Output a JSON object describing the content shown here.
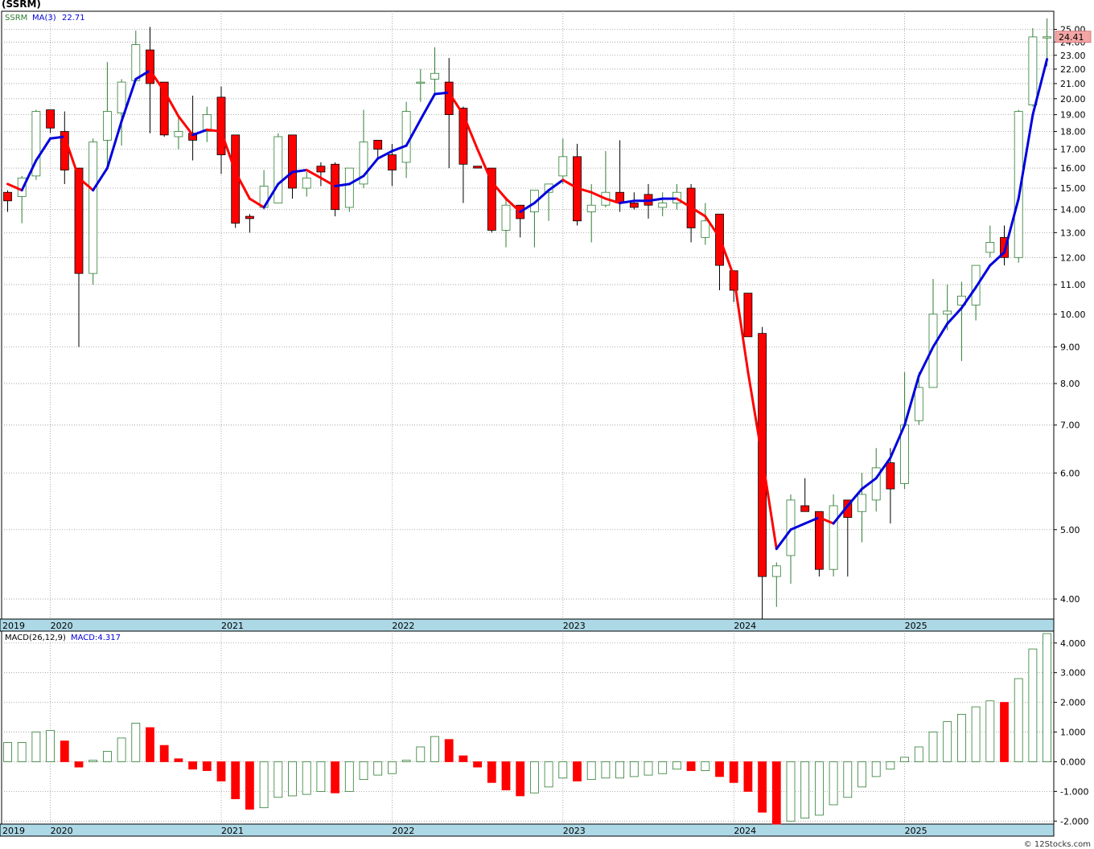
{
  "title": "(SSRM)",
  "watermark": "© 12Stocks.com",
  "colors": {
    "up_candle": "#2e7d32",
    "down_candle": "#ff0000",
    "ma_up": "#0000dd",
    "ma_down": "#ff0000",
    "macd_up": "#2e7d32",
    "macd_down": "#ff0000",
    "grid": "#999999",
    "axis_band": "#add8e6",
    "price_label_bg": "#f4a6a6"
  },
  "chart_data": [
    {
      "type": "candlestick",
      "name": "price-panel",
      "legend": {
        "symbol": "SSRM",
        "ma_label": "MA(3)",
        "ma_value": "22.71"
      },
      "last_price_label": "24.41",
      "scale": "log",
      "ylim": [
        3.75,
        26.5
      ],
      "y_ticks": [
        "4.00",
        "5.00",
        "6.00",
        "7.00",
        "8.00",
        "9.00",
        "10.00",
        "11.00",
        "12.00",
        "13.00",
        "14.00",
        "15.00",
        "16.00",
        "17.00",
        "18.00",
        "19.00",
        "20.00",
        "21.00",
        "22.00",
        "23.00",
        "24.00",
        "25.00"
      ],
      "x_labels": [
        "2019",
        "2020",
        "2021",
        "2022",
        "2023",
        "2024",
        "2025"
      ],
      "candles": [
        [
          14.8,
          14.9,
          13.9,
          14.4
        ],
        [
          14.6,
          15.6,
          13.4,
          15.5
        ],
        [
          15.6,
          19.3,
          15.4,
          19.2
        ],
        [
          19.3,
          18.5,
          17.9,
          18.2
        ],
        [
          18.0,
          19.2,
          15.2,
          15.9
        ],
        [
          16.0,
          16.0,
          9.0,
          11.4
        ],
        [
          11.4,
          17.6,
          11.0,
          17.4
        ],
        [
          17.5,
          22.5,
          16.0,
          19.2
        ],
        [
          19.1,
          21.3,
          17.2,
          21.1
        ],
        [
          21.2,
          24.9,
          21.3,
          23.8
        ],
        [
          23.4,
          25.2,
          17.9,
          21.0
        ],
        [
          21.1,
          21.1,
          17.7,
          17.8
        ],
        [
          17.7,
          19.0,
          17.0,
          18.0
        ],
        [
          17.9,
          20.2,
          16.4,
          17.5
        ],
        [
          18.0,
          19.5,
          17.4,
          19.0
        ],
        [
          20.1,
          20.8,
          15.7,
          16.7
        ],
        [
          17.8,
          17.8,
          13.2,
          13.4
        ],
        [
          13.7,
          13.8,
          13.0,
          13.6
        ],
        [
          14.1,
          15.9,
          14.0,
          15.1
        ],
        [
          14.3,
          17.9,
          14.3,
          17.7
        ],
        [
          17.8,
          17.8,
          14.5,
          15.0
        ],
        [
          15.0,
          15.8,
          14.6,
          15.5
        ],
        [
          16.1,
          16.3,
          15.1,
          15.8
        ],
        [
          16.2,
          16.3,
          13.7,
          14.0
        ],
        [
          14.1,
          16.0,
          13.9,
          16.0
        ],
        [
          15.2,
          19.3,
          15.0,
          17.4
        ],
        [
          17.5,
          17.0,
          16.5,
          17.0
        ],
        [
          16.7,
          17.3,
          15.1,
          15.9
        ],
        [
          16.3,
          19.8,
          15.5,
          19.2
        ],
        [
          21.1,
          22.0,
          19.8,
          21.1
        ],
        [
          21.3,
          23.6,
          20.3,
          21.7
        ],
        [
          21.1,
          22.8,
          16.0,
          19.0
        ],
        [
          19.4,
          19.5,
          14.3,
          16.2
        ],
        [
          16.1,
          16.0,
          16.0,
          16.0
        ],
        [
          16.0,
          16.0,
          13.0,
          13.1
        ],
        [
          13.1,
          14.6,
          12.4,
          14.2
        ],
        [
          14.2,
          14.2,
          12.8,
          13.6
        ],
        [
          13.9,
          14.9,
          12.4,
          14.9
        ],
        [
          14.8,
          14.9,
          13.5,
          15.2
        ],
        [
          15.6,
          17.6,
          15.2,
          16.6
        ],
        [
          16.6,
          17.3,
          13.3,
          13.5
        ],
        [
          13.9,
          15.2,
          12.6,
          14.2
        ],
        [
          14.2,
          16.9,
          14.1,
          14.8
        ],
        [
          14.8,
          17.5,
          13.9,
          14.3
        ],
        [
          14.3,
          14.8,
          14.0,
          14.1
        ],
        [
          14.7,
          15.2,
          13.6,
          14.2
        ],
        [
          14.1,
          14.8,
          13.7,
          14.3
        ],
        [
          14.3,
          15.2,
          14.0,
          14.8
        ],
        [
          15.0,
          15.2,
          12.6,
          13.2
        ],
        [
          12.8,
          14.3,
          12.5,
          13.5
        ],
        [
          13.8,
          13.8,
          10.8,
          11.7
        ],
        [
          11.5,
          11.5,
          10.4,
          10.8
        ],
        [
          10.7,
          10.7,
          9.3,
          9.3
        ],
        [
          9.4,
          9.6,
          3.75,
          4.3
        ],
        [
          4.3,
          4.5,
          3.9,
          4.45
        ],
        [
          4.6,
          5.6,
          4.2,
          5.5
        ],
        [
          5.4,
          5.9,
          5.3,
          5.3
        ],
        [
          5.3,
          5.3,
          4.3,
          4.4
        ],
        [
          4.4,
          5.6,
          4.3,
          5.4
        ],
        [
          5.5,
          5.5,
          4.3,
          5.2
        ],
        [
          5.3,
          6.0,
          4.8,
          5.6
        ],
        [
          5.5,
          6.5,
          5.3,
          6.1
        ],
        [
          6.2,
          6.5,
          5.1,
          5.7
        ],
        [
          5.8,
          8.3,
          5.7,
          7.0
        ],
        [
          7.1,
          8.3,
          7.0,
          7.9
        ],
        [
          7.9,
          11.2,
          7.9,
          10.0
        ],
        [
          10.0,
          11.0,
          9.5,
          10.1
        ],
        [
          10.3,
          11.1,
          8.6,
          10.6
        ],
        [
          10.3,
          11.4,
          9.8,
          11.7
        ],
        [
          12.2,
          13.3,
          12.0,
          12.6
        ],
        [
          12.8,
          13.3,
          11.7,
          12.0
        ],
        [
          12.0,
          19.3,
          11.8,
          19.2
        ],
        [
          19.6,
          25.1,
          19.5,
          24.4
        ],
        [
          24.41,
          25.9,
          22.2,
          24.41
        ]
      ],
      "ma3": [
        15.2,
        14.9,
        16.4,
        17.6,
        17.7,
        15.5,
        14.9,
        16.0,
        18.6,
        21.3,
        21.9,
        20.5,
        18.9,
        17.8,
        18.1,
        18.0,
        15.8,
        14.5,
        14.1,
        15.2,
        15.8,
        15.9,
        15.5,
        15.1,
        15.2,
        15.6,
        16.5,
        16.9,
        17.2,
        18.7,
        20.3,
        20.4,
        19.0,
        17.0,
        15.3,
        14.5,
        13.9,
        14.3,
        14.9,
        15.4,
        15.0,
        14.8,
        14.5,
        14.3,
        14.4,
        14.4,
        14.5,
        14.5,
        14.1,
        13.7,
        12.8,
        11.3,
        8.3,
        6.3,
        4.7,
        5.0,
        5.1,
        5.2,
        5.1,
        5.4,
        5.7,
        5.9,
        6.3,
        7.0,
        8.2,
        9.0,
        9.7,
        10.2,
        10.9,
        11.7,
        12.2,
        14.5,
        19.0,
        22.71
      ],
      "ma3_direction": "up"
    },
    {
      "type": "bar",
      "name": "macd-panel",
      "legend": {
        "indicator": "MACD(26,12,9)",
        "value_label": "MACD:4.317"
      },
      "ylim": [
        -2.1,
        4.4
      ],
      "y_ticks": [
        "4.000",
        "3.000",
        "2.000",
        "1.000",
        "0.000",
        "-1.000",
        "-2.000"
      ],
      "x_labels": [
        "2019",
        "2020",
        "2021",
        "2022",
        "2023",
        "2024",
        "2025"
      ],
      "values": [
        0.65,
        0.65,
        1.0,
        1.05,
        0.7,
        -0.18,
        0.05,
        0.35,
        0.8,
        1.3,
        1.15,
        0.55,
        0.1,
        -0.25,
        -0.3,
        -0.65,
        -1.25,
        -1.6,
        -1.55,
        -1.2,
        -1.15,
        -1.1,
        -1.0,
        -1.05,
        -1.0,
        -0.6,
        -0.45,
        -0.4,
        0.05,
        0.5,
        0.85,
        0.75,
        0.2,
        -0.18,
        -0.7,
        -0.95,
        -1.15,
        -1.05,
        -0.85,
        -0.55,
        -0.65,
        -0.6,
        -0.55,
        -0.55,
        -0.5,
        -0.45,
        -0.4,
        -0.25,
        -0.3,
        -0.3,
        -0.5,
        -0.7,
        -1.0,
        -1.7,
        -2.1,
        -2.0,
        -1.9,
        -1.8,
        -1.45,
        -1.2,
        -0.85,
        -0.5,
        -0.25,
        0.15,
        0.5,
        1.0,
        1.35,
        1.6,
        1.85,
        2.05,
        2.0,
        2.8,
        3.8,
        4.317
      ]
    }
  ]
}
